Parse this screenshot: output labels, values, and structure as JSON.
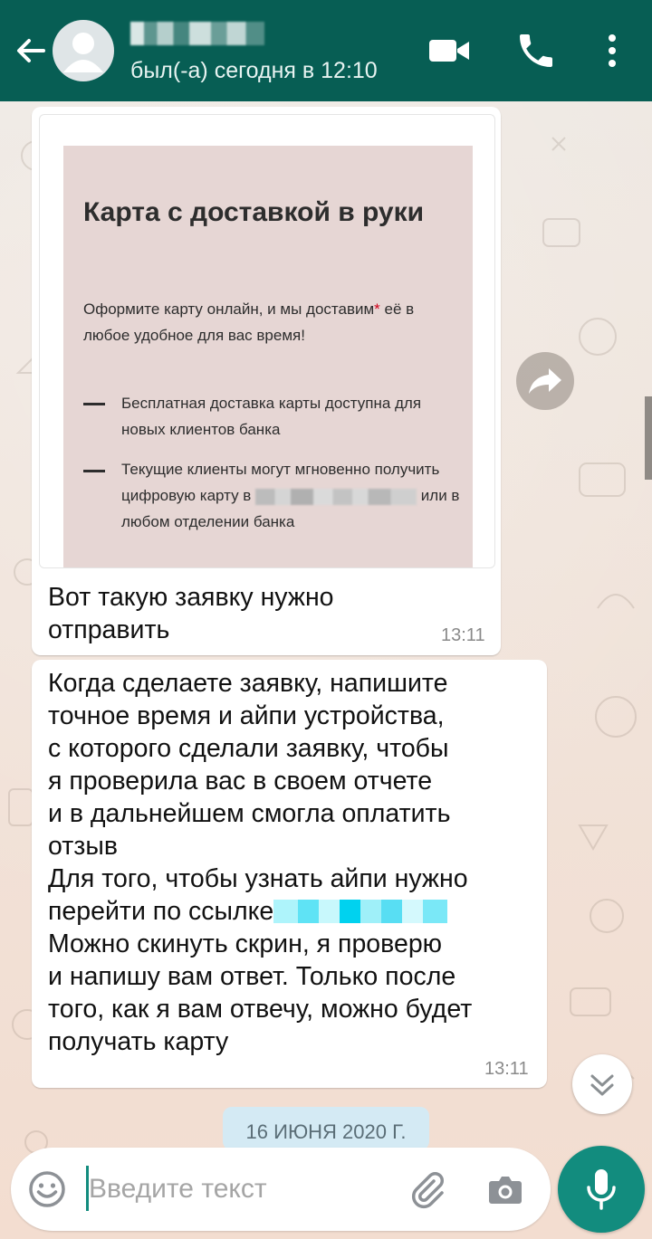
{
  "header": {
    "status": "был(-а) сегодня в 12:10",
    "icons": [
      "back-arrow-icon",
      "video-call-icon",
      "voice-call-icon",
      "more-options-icon"
    ]
  },
  "messages": [
    {
      "type": "image",
      "image": {
        "title": "Карта с доставкой в руки",
        "desc_part1": "Оформите карту онлайн, и мы доставим",
        "desc_star": "*",
        "desc_part2": " её в любое удобное для вас время!",
        "bullet1": "Бесплатная доставка карты доступна для новых клиентов банка",
        "bullet2_part1": "Текущие клиенты могут мгновенно получить цифровую карту в",
        "bullet2_part2": " или в любом отделении банка"
      },
      "caption": "Вот такую заявку нужно\nотправить",
      "time": "13:11"
    },
    {
      "type": "text",
      "text_part1": "Когда сделаете заявку, напишите\nточное время и айпи устройства,\nс которого сделали заявку, чтобы\nя проверила вас в своем отчете\nи в дальнейшем смогла оплатить\nотзыв\nДля того, чтобы узнать айпи нужно\nперейти по ссылке",
      "text_part2": "\nМожно скинуть скрин, я проверю\nи напишу вам ответ. Только после\nтого, как я вам отвечу, можно будет\nполучать карту",
      "time": "13:11"
    }
  ],
  "date_chip": "16 ИЮНЯ 2020 Г.",
  "input": {
    "placeholder": "Введите текст",
    "value": ""
  },
  "colors": {
    "header": "#075e54",
    "accent": "#128c7e",
    "bubble": "#ffffff",
    "date_chip": "#d4eaf4"
  }
}
